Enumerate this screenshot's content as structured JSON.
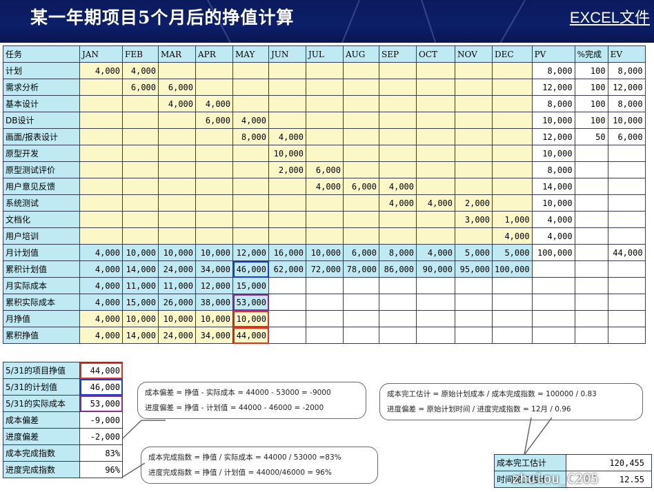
{
  "header": {
    "title": "某一年期项目5个月后的挣值计算",
    "link": "EXCEL文件"
  },
  "grid": {
    "columns": [
      "任务",
      "JAN",
      "FEB",
      "MAR",
      "APR",
      "MAY",
      "JUN",
      "JUL",
      "AUG",
      "SEP",
      "OCT",
      "NOV",
      "DEC",
      "PV",
      "%完成",
      "EV"
    ],
    "tasks": [
      {
        "name": "计划",
        "vals": [
          "4,000",
          "4,000",
          "",
          "",
          "",
          "",
          "",
          "",
          "",
          "",
          "",
          ""
        ],
        "pv": "8,000",
        "pct": "100",
        "ev": "8,000"
      },
      {
        "name": "需求分析",
        "vals": [
          "",
          "6,000",
          "6,000",
          "",
          "",
          "",
          "",
          "",
          "",
          "",
          "",
          ""
        ],
        "pv": "12,000",
        "pct": "100",
        "ev": "12,000"
      },
      {
        "name": "基本设计",
        "vals": [
          "",
          "",
          "4,000",
          "4,000",
          "",
          "",
          "",
          "",
          "",
          "",
          "",
          ""
        ],
        "pv": "8,000",
        "pct": "100",
        "ev": "8,000"
      },
      {
        "name": "DB设计",
        "vals": [
          "",
          "",
          "",
          "6,000",
          "4,000",
          "",
          "",
          "",
          "",
          "",
          "",
          ""
        ],
        "pv": "10,000",
        "pct": "100",
        "ev": "10,000"
      },
      {
        "name": "画面/报表设计",
        "vals": [
          "",
          "",
          "",
          "",
          "8,000",
          "4,000",
          "",
          "",
          "",
          "",
          "",
          ""
        ],
        "pv": "12,000",
        "pct": "50",
        "ev": "6,000"
      },
      {
        "name": "原型开发",
        "vals": [
          "",
          "",
          "",
          "",
          "",
          "10,000",
          "",
          "",
          "",
          "",
          "",
          ""
        ],
        "pv": "10,000",
        "pct": "",
        "ev": ""
      },
      {
        "name": "原型测试评价",
        "vals": [
          "",
          "",
          "",
          "",
          "",
          "2,000",
          "6,000",
          "",
          "",
          "",
          "",
          ""
        ],
        "pv": "8,000",
        "pct": "",
        "ev": ""
      },
      {
        "name": "用户意见反馈",
        "vals": [
          "",
          "",
          "",
          "",
          "",
          "",
          "4,000",
          "6,000",
          "4,000",
          "",
          "",
          ""
        ],
        "pv": "14,000",
        "pct": "",
        "ev": ""
      },
      {
        "name": "系统测试",
        "vals": [
          "",
          "",
          "",
          "",
          "",
          "",
          "",
          "",
          "4,000",
          "4,000",
          "2,000",
          ""
        ],
        "pv": "10,000",
        "pct": "",
        "ev": ""
      },
      {
        "name": "文档化",
        "vals": [
          "",
          "",
          "",
          "",
          "",
          "",
          "",
          "",
          "",
          "",
          "3,000",
          "1,000"
        ],
        "pv": "4,000",
        "pct": "",
        "ev": ""
      },
      {
        "name": "用户培训",
        "vals": [
          "",
          "",
          "",
          "",
          "",
          "",
          "",
          "",
          "",
          "",
          "",
          "4,000"
        ],
        "pv": "4,000",
        "pct": "",
        "ev": ""
      }
    ],
    "monthly_pv": {
      "name": "月计划值",
      "vals": [
        "4,000",
        "10,000",
        "10,000",
        "10,000",
        "12,000",
        "16,000",
        "10,000",
        "6,000",
        "8,000",
        "4,000",
        "5,000",
        "5,000"
      ],
      "pv": "100,000",
      "pct": "",
      "ev": "44,000"
    },
    "cumulative_pv": {
      "name": "累积计划值",
      "vals": [
        "4,000",
        "14,000",
        "24,000",
        "34,000",
        "46,000",
        "62,000",
        "72,000",
        "78,000",
        "86,000",
        "90,000",
        "95,000",
        "100,000"
      ]
    },
    "actual_cost": {
      "name": "月实际成本",
      "vals": [
        "4,000",
        "11,000",
        "11,000",
        "12,000",
        "15,000"
      ]
    },
    "cumulative_ac": {
      "name": "累积实际成本",
      "vals": [
        "4,000",
        "15,000",
        "26,000",
        "38,000",
        "53,000"
      ]
    },
    "monthly_ev": {
      "name": "月挣值",
      "vals": [
        "4,000",
        "10,000",
        "10,000",
        "10,000",
        "10,000"
      ]
    },
    "cumulative_ev": {
      "name": "累积挣值",
      "vals": [
        "4,000",
        "14,000",
        "24,000",
        "34,000",
        "44,000"
      ]
    }
  },
  "summary": [
    {
      "label": "5/31的项目挣值",
      "value": "44,000"
    },
    {
      "label": "5/31的计划值",
      "value": "46,000"
    },
    {
      "label": "5/31的实际成本",
      "value": "53,000"
    },
    {
      "label": "成本偏差",
      "value": "-9,000"
    },
    {
      "label": "进度偏差",
      "value": "-2,000"
    },
    {
      "label": "成本完成指数",
      "value": "83%"
    },
    {
      "label": "进度完成指数",
      "value": "96%"
    }
  ],
  "callouts": {
    "variance": [
      "成本偏差 = 挣值 - 实际成本 = 44000 - 53000 = -9000",
      "进度偏差 = 挣值 - 计划值 = 44000 - 46000 = -2000"
    ],
    "index": [
      "成本完成指数 = 挣值 / 实际成本 = 44000 / 53000 =83%",
      "进度完成指数 = 挣值 / 计划值 = 44000/46000 = 96%"
    ],
    "estimate": [
      "成本完工估计 = 原始计划成本 / 成本完成指数 = 100000 / 0.83",
      "进度偏差 = 原始计划时间 / 进度完成指数 = 12月 / 0.96"
    ]
  },
  "estimate_box": [
    {
      "label": "成本完工估计",
      "value": "120,455"
    },
    {
      "label": "时间完工估计",
      "value": "12.55"
    }
  ],
  "watermark": "zhulou_C205"
}
